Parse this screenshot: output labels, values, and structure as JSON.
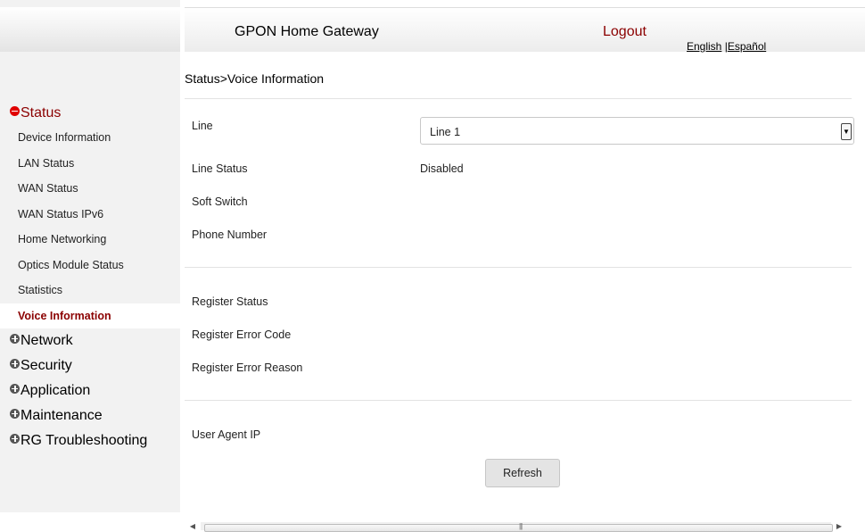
{
  "header": {
    "title": "GPON Home Gateway",
    "logout": "Logout",
    "lang_english": "English",
    "lang_sep": " |",
    "lang_spanish": "Español"
  },
  "sidebar": {
    "status_group": "Status",
    "status_items": [
      "Device Information",
      "LAN Status",
      "WAN Status",
      "WAN Status IPv6",
      "Home Networking",
      "Optics Module Status",
      "Statistics",
      "Voice Information"
    ],
    "active_item": "Voice Information",
    "groups": [
      "Network",
      "Security",
      "Application",
      "Maintenance",
      "RG Troubleshooting"
    ]
  },
  "breadcrumb": "Status>Voice Information",
  "form": {
    "line_label": "Line",
    "line_selected": "Line 1",
    "line_status_label": "Line Status",
    "line_status_value": "Disabled",
    "soft_switch_label": "Soft Switch",
    "phone_number_label": "Phone Number",
    "register_status_label": "Register Status",
    "register_error_code_label": "Register Error Code",
    "register_error_reason_label": "Register Error Reason",
    "user_agent_ip_label": "User Agent IP",
    "refresh_label": "Refresh"
  },
  "colors": {
    "accent": "#8b0000",
    "sidebar_bg": "#f2f2f2"
  }
}
